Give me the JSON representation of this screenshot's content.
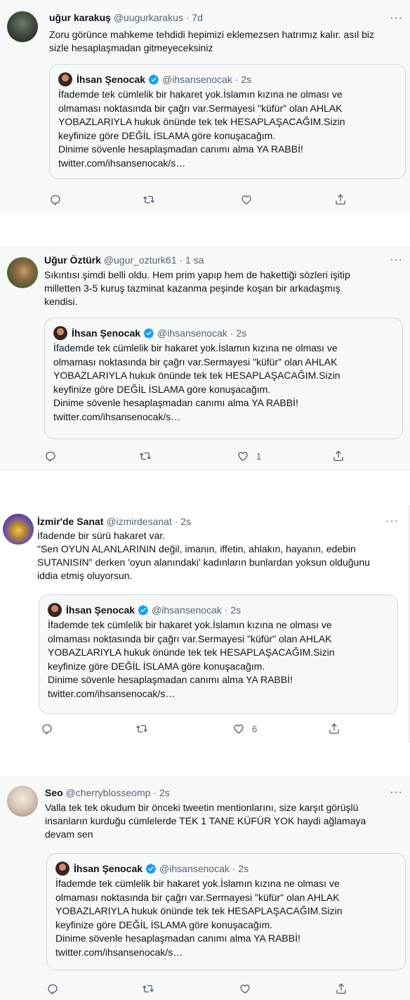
{
  "quote": {
    "name": "İhsan Şenocak",
    "handle_time": "@ihsansenocak · 2s",
    "text": "İfademde tek cümlelik bir hakaret yok.İslamın kızına ne olması ve\nolmaması noktasında bir çağrı var.Sermayesi \"küfür\" olan AHLAK\nYOBAZLARIYLA hukuk önünde tek tek HESAPLAŞACAĞIM.Sizin\nkeyfinize göre DEĞİL İSLAMA göre konuşacağım.\nDinime sövenle hesaplaşmadan canımı alma YA RABBİ!\ntwitter.com/ihsansenocak/s…"
  },
  "tweets": [
    {
      "name": "uğur karakuş",
      "handle_time": "@uugurkarakus · 7d",
      "text": "Zoru görünce mahkeme tehdidi hepimizi eklemezsen hatrımız kalır. asıl biz\nsizle hesaplaşmadan gitmeyeceksiniz",
      "like_count": "",
      "avatar_color": "#3a4438"
    },
    {
      "name": "Uğur Öztürk",
      "handle_time": "@ugur_ozturk61 · 1 sa",
      "text": "Sıkıntısı şimdi belli oldu. Hem prim yapıp hem de hakettiği sözleri işitip\nmilletten 3-5 kuruş tazminat kazanma peşinde koşan bir arkadaşmış\nkendisi.",
      "like_count": "1",
      "avatar_color": "#5b6a3a"
    },
    {
      "name": "İzmir'de Sanat",
      "handle_time": "@izmirdesanat · 2s",
      "text": "İfadende bir sürü hakaret var.\n\"Sen OYUN ALANLARININ değil, imanın, iffetin, ahlakın, hayanın, edebin\nSUTANISIN\" derken 'oyun alanındaki' kadınların bunlardan yoksun olduğunu\niddia etmiş oluyorsun.",
      "like_count": "6",
      "avatar_color": "#4b3a8c"
    },
    {
      "name": "Seo",
      "handle_time": "@cherryblosseomp · 2s",
      "text": "Valla tek tek okudum bir önceki tweetin mentionlarını, size karşıt görüşlü\ninsanların kurduğu cümlelerde TEK 1 TANE KÜFÜR YOK haydi ağlamaya\ndevam sen",
      "like_count": "",
      "avatar_color": "#d9c8b8"
    }
  ],
  "more_label": "···",
  "colors": {
    "verified": "#1d9bf0",
    "muted": "#536471"
  }
}
